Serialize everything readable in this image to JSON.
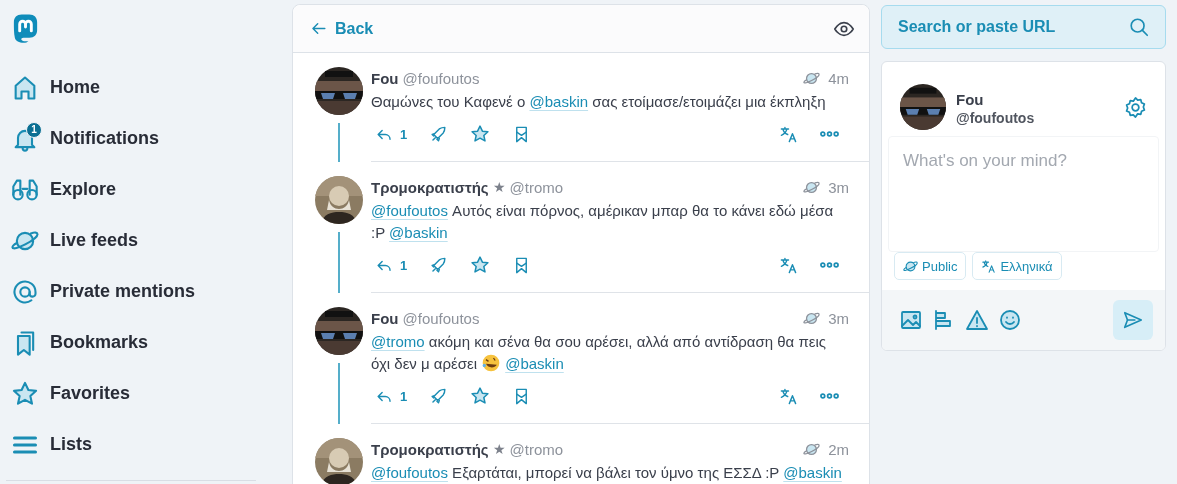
{
  "sidebar": {
    "items": [
      {
        "label": "Home"
      },
      {
        "label": "Notifications",
        "badge": "1"
      },
      {
        "label": "Explore"
      },
      {
        "label": "Live feeds"
      },
      {
        "label": "Private mentions"
      },
      {
        "label": "Bookmarks"
      },
      {
        "label": "Favorites"
      },
      {
        "label": "Lists"
      }
    ]
  },
  "column": {
    "back": "Back",
    "posts": [
      {
        "author": "Fou",
        "handle": "@foufoutos",
        "avatar": {
          "kind": "picture"
        },
        "time": "4m",
        "content": [
          {
            "kind": "text",
            "text": "Θαμώνες του Καφενέ ο "
          },
          {
            "kind": "mention",
            "text": "@baskin"
          },
          {
            "kind": "text",
            "text": " σας ετοίμασε/ετοιμάζει μια έκπληξη"
          }
        ],
        "actions": {
          "replies": "1"
        }
      },
      {
        "author": "Τρομοκρατιστής",
        "bot_badge": "★",
        "handle": "@tromo",
        "avatar": {
          "kind": "picture"
        },
        "time": "3m",
        "content": [
          {
            "kind": "mention",
            "text": "@foufoutos"
          },
          {
            "kind": "text",
            "text": " Αυτός είναι πόρνος, αμέρικαν μπαρ θα το κάνει εδώ μέσα :P "
          },
          {
            "kind": "mention",
            "text": "@baskin"
          }
        ],
        "actions": {
          "replies": "1"
        }
      },
      {
        "author": "Fou",
        "handle": "@foufoutos",
        "avatar": {
          "kind": "picture"
        },
        "time": "3m",
        "content": [
          {
            "kind": "mention",
            "text": "@tromo"
          },
          {
            "kind": "text",
            "text": " ακόμη και σένα θα σου αρέσει, αλλά από αντίδραση θα πεις όχι δεν μ αρέσει "
          },
          {
            "kind": "emoji"
          },
          {
            "kind": "mention",
            "text": "@baskin"
          }
        ],
        "actions": {
          "replies": "1"
        }
      },
      {
        "author": "Τρομοκρατιστής",
        "bot_badge": "★",
        "handle": "@tromo",
        "avatar": {
          "kind": "picture"
        },
        "time": "2m",
        "content": [
          {
            "kind": "mention",
            "text": "@foufoutos"
          },
          {
            "kind": "text",
            "text": " Εξαρτάται, μπορεί να βάλει τον ύμνο της ΕΣΣΔ :P "
          },
          {
            "kind": "mention",
            "text": "@baskin"
          }
        ]
      }
    ]
  },
  "search": {
    "placeholder": "Search or paste URL"
  },
  "compose": {
    "name": "Fou",
    "handle": "@foufoutos",
    "avatar": {
      "kind": "picture"
    },
    "placeholder": "What's on your mind?",
    "visibility": "Public",
    "language": "Ελληνικά"
  }
}
